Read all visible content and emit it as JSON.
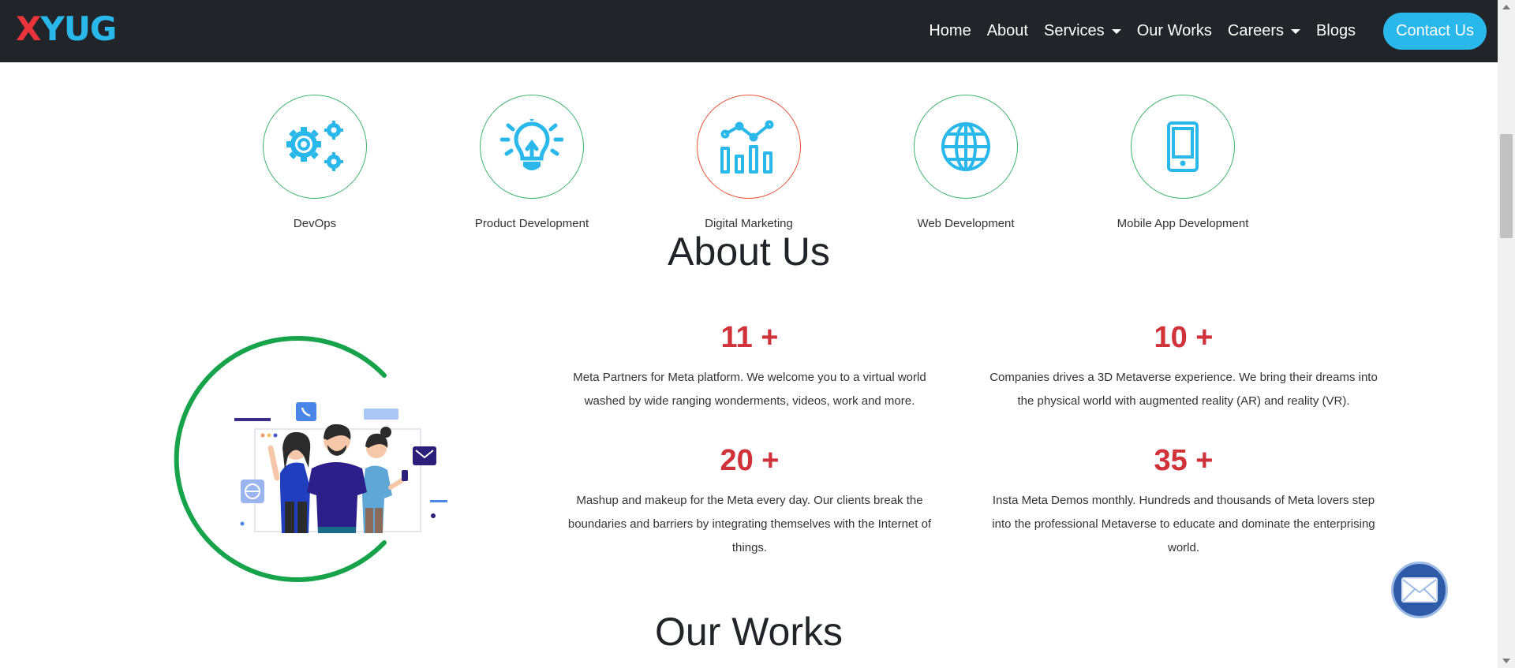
{
  "brand": {
    "logo_letters": [
      "X",
      "Y",
      "U",
      "G"
    ],
    "logo_colors": [
      "#e8343a",
      "#2ab7ea",
      "#2ab7ea",
      "#2ab7ea"
    ]
  },
  "nav": {
    "items": [
      {
        "label": "Home",
        "dropdown": false
      },
      {
        "label": "About",
        "dropdown": false
      },
      {
        "label": "Services",
        "dropdown": true
      },
      {
        "label": "Our Works",
        "dropdown": false
      },
      {
        "label": "Careers",
        "dropdown": true
      },
      {
        "label": "Blogs",
        "dropdown": false
      }
    ],
    "contact_label": "Contact Us"
  },
  "services": [
    {
      "label": "DevOps",
      "icon": "gears-icon"
    },
    {
      "label": "Product Development",
      "icon": "lightbulb-icon"
    },
    {
      "label": "Digital Marketing",
      "icon": "bar-chart-icon"
    },
    {
      "label": "Web Development",
      "icon": "globe-icon"
    },
    {
      "label": "Mobile App Development",
      "icon": "mobile-phone-icon"
    }
  ],
  "about": {
    "title": "About Us",
    "stats": [
      {
        "number": "11 +",
        "text": "Meta Partners for Meta platform. We welcome you to a virtual world washed by wide ranging wonderments, videos, work and more."
      },
      {
        "number": "10 +",
        "text": "Companies drives a 3D Metaverse experience. We bring their dreams into the physical world with augmented reality (AR) and reality (VR)."
      },
      {
        "number": "20 +",
        "text": "Mashup and makeup for the Meta every day. Our clients break the boundaries and barriers by integrating themselves with the Internet of things."
      },
      {
        "number": "35 +",
        "text": "Insta Meta Demos monthly. Hundreds and thousands of Meta lovers step into the professional Metaverse to educate and dominate the enterprising world."
      }
    ]
  },
  "works": {
    "title": "Our Works"
  },
  "colors": {
    "navbar_bg": "#212529",
    "accent_blue": "#2ab7ea",
    "stat_red": "#d0323a",
    "circle_green": "#3fb36d",
    "circle_red": "#e8543a",
    "arc_green": "#16a34a",
    "fab_blue": "#2f5aa8"
  }
}
